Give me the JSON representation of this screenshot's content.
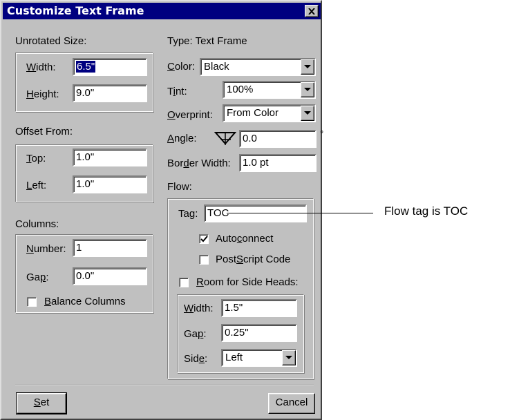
{
  "dialog": {
    "title": "Customize Text Frame"
  },
  "unrotated": {
    "heading": "Unrotated Size:",
    "width_label": {
      "pre": "",
      "u": "W",
      "post": "idth:"
    },
    "width_value": "6.5\"",
    "height_label": {
      "pre": "",
      "u": "H",
      "post": "eight:"
    },
    "height_value": "9.0\""
  },
  "offset": {
    "heading": "Offset From:",
    "top_label": {
      "pre": "",
      "u": "T",
      "post": "op:"
    },
    "top_value": "1.0\"",
    "left_label": {
      "pre": "",
      "u": "L",
      "post": "eft:"
    },
    "left_value": "1.0\""
  },
  "columns": {
    "heading": "Columns:",
    "number_label": {
      "pre": "",
      "u": "N",
      "post": "umber:"
    },
    "number_value": "1",
    "gap_label": {
      "pre": "Ga",
      "u": "p",
      "post": ":"
    },
    "gap_value": "0.0\"",
    "balance_label": {
      "pre": "",
      "u": "B",
      "post": "alance Columns"
    }
  },
  "type": {
    "label": "Type:",
    "value": "Text Frame"
  },
  "color": {
    "label": {
      "pre": "",
      "u": "C",
      "post": "olor:"
    },
    "value": "Black"
  },
  "tint": {
    "label": {
      "pre": "T",
      "u": "i",
      "post": "nt:"
    },
    "value": "100%"
  },
  "overprint": {
    "label": {
      "pre": "",
      "u": "O",
      "post": "verprint:"
    },
    "value": "From Color"
  },
  "angle": {
    "label": {
      "pre": "",
      "u": "A",
      "post": "ngle:"
    },
    "value": "0.0",
    "unit": "°"
  },
  "border": {
    "label": {
      "pre": "Bor",
      "u": "d",
      "post": "er Width:"
    },
    "value": "1.0 pt"
  },
  "flow": {
    "heading": "Flow:",
    "tag_label": {
      "pre": "Ta",
      "u": "g",
      "post": ":"
    },
    "tag_value": "TOC",
    "autoconnect": {
      "pre": "Auto",
      "u": "c",
      "post": "onnect",
      "checked": true
    },
    "postscript": {
      "pre": "Post",
      "u": "S",
      "post": "cript Code",
      "checked": false
    },
    "side_heads": {
      "pre": "",
      "u": "R",
      "post": "oom for Side Heads:",
      "checked": false
    },
    "sh_width_label": {
      "pre": "",
      "u": "W",
      "post": "idth:"
    },
    "sh_width_value": "1.5\"",
    "sh_gap_label": {
      "pre": "Ga",
      "u": "p",
      "post": ":"
    },
    "sh_gap_value": "0.25\"",
    "sh_side_label": {
      "pre": "Sid",
      "u": "e",
      "post": ":"
    },
    "sh_side_value": "Left"
  },
  "buttons": {
    "set": {
      "pre": "",
      "u": "S",
      "post": "et"
    },
    "cancel": "Cancel"
  },
  "callout": "Flow tag is TOC"
}
